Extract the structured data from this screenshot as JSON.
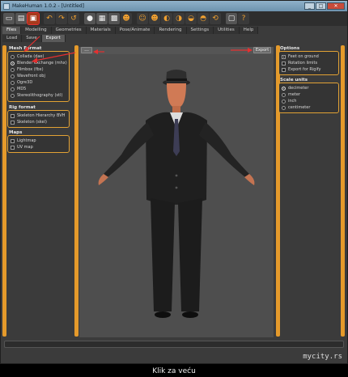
{
  "window": {
    "title": "MakeHuman 1.0.2 - [Untitled]"
  },
  "window_buttons": [
    "_",
    "□",
    "✕"
  ],
  "toolbar_icons": [
    "file-new-icon",
    "save-icon",
    "export-icon",
    "undo-icon",
    "redo-icon",
    "reset-icon",
    "smooth-icon",
    "wireframe-icon",
    "background-icon",
    "pose-icon",
    "front-view-icon",
    "back-view-icon",
    "left-view-icon",
    "right-view-icon",
    "top-view-icon",
    "bottom-view-icon",
    "reset-camera-icon",
    "screenshot-icon",
    "help-icon"
  ],
  "menu": {
    "tabs": [
      "Files",
      "Modelling",
      "Geometries",
      "Materials",
      "Pose/Animate",
      "Rendering",
      "Settings",
      "Utilities",
      "Help"
    ],
    "selected": "Files"
  },
  "subtabs": {
    "tabs": [
      "Load",
      "Save",
      "Export"
    ],
    "selected": "Export"
  },
  "mesh_format": {
    "title": "Mesh Format",
    "options": [
      "Collada (dae)",
      "Blender exchange (mhx)",
      "Filmbox (fbx)",
      "Wavefront obj",
      "Ogre3D",
      "MD5",
      "Stereolithography (stl)"
    ],
    "selected": "Blender exchange (mhx)"
  },
  "rig_format": {
    "title": "Rig format",
    "options": [
      "Skeleton Hierarchy BVH",
      "Skeleton (skel)"
    ]
  },
  "maps": {
    "title": "Maps",
    "options": [
      "Lightmap",
      "UV map"
    ]
  },
  "options": {
    "title": "Options",
    "items": [
      {
        "label": "Feet on ground",
        "checked": true
      },
      {
        "label": "Rotation limits",
        "checked": false
      },
      {
        "label": "Export for Rigify",
        "checked": false
      }
    ]
  },
  "scale_units": {
    "title": "Scale units",
    "options": [
      "decimeter",
      "meter",
      "inch",
      "centimeter"
    ],
    "selected": "decimeter"
  },
  "command": {
    "dots_label": "...",
    "export_label": "Export"
  },
  "footer": {
    "caption": "Klik za veću",
    "watermark": "mycity.rs"
  },
  "colors": {
    "accent": "#e59a2b",
    "highlight": "#e53030",
    "background": "#3b3b3b",
    "viewport": "#4e4e4e"
  }
}
